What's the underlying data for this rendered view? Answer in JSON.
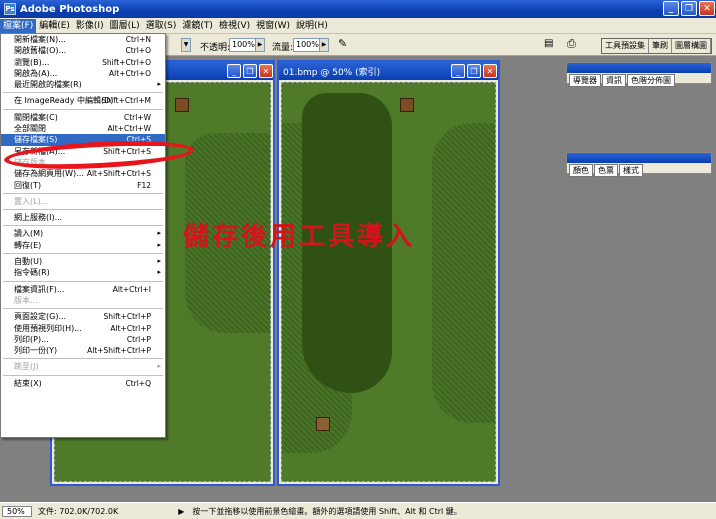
{
  "app": {
    "title": "Adobe Photoshop"
  },
  "menubar": {
    "items": [
      "檔案(F)",
      "編輯(E)",
      "影像(I)",
      "圖層(L)",
      "選取(S)",
      "濾鏡(T)",
      "檢視(V)",
      "視窗(W)",
      "說明(H)"
    ]
  },
  "options": {
    "opacity_label": "不透明:",
    "opacity_value": "100%",
    "flow_label": "流量:",
    "flow_value": "100%"
  },
  "palette_tabs": [
    "工具預設集",
    "筆刷",
    "圖層構圖"
  ],
  "palettes": [
    {
      "tabs": [
        "導覽器",
        "資訊",
        "色階分佈圖"
      ]
    },
    {
      "tabs": [
        "顏色",
        "色票",
        "樣式"
      ]
    }
  ],
  "documents": [
    {
      "title": ""
    },
    {
      "title": "01.bmp @ 50% (索引)"
    }
  ],
  "file_menu": {
    "items": [
      {
        "label": "開新檔案(N)...",
        "shortcut": "Ctrl+N"
      },
      {
        "label": "開啟舊檔(O)...",
        "shortcut": "Ctrl+O"
      },
      {
        "label": "瀏覽(B)...",
        "shortcut": "Shift+Ctrl+O"
      },
      {
        "label": "開啟為(A)...",
        "shortcut": "Alt+Ctrl+O"
      },
      {
        "label": "最近開啟的檔案(R)",
        "submenu": true
      },
      {
        "sep": true
      },
      {
        "label": "在 ImageReady 中編輯(D)",
        "shortcut": "Shift+Ctrl+M"
      },
      {
        "sep": true
      },
      {
        "label": "關閉檔案(C)",
        "shortcut": "Ctrl+W"
      },
      {
        "label": "全部關閉",
        "shortcut": "Alt+Ctrl+W"
      },
      {
        "label": "儲存檔案(S)",
        "shortcut": "Ctrl+S",
        "highlight": true
      },
      {
        "label": "另存新檔(A)...",
        "shortcut": "Shift+Ctrl+S"
      },
      {
        "label": "儲存版本...",
        "disabled": true
      },
      {
        "label": "儲存為網頁用(W)...",
        "shortcut": "Alt+Shift+Ctrl+S"
      },
      {
        "label": "回復(T)",
        "shortcut": "F12"
      },
      {
        "sep": true
      },
      {
        "label": "置入(L)...",
        "disabled": true
      },
      {
        "sep": true
      },
      {
        "label": "網上服務(I)..."
      },
      {
        "sep": true
      },
      {
        "label": "讀入(M)",
        "submenu": true
      },
      {
        "label": "轉存(E)",
        "submenu": true
      },
      {
        "sep": true
      },
      {
        "label": "自動(U)",
        "submenu": true
      },
      {
        "label": "指令碼(R)",
        "submenu": true
      },
      {
        "sep": true
      },
      {
        "label": "檔案資訊(F)...",
        "shortcut": "Alt+Ctrl+I"
      },
      {
        "label": "版本...",
        "disabled": true
      },
      {
        "sep": true
      },
      {
        "label": "頁面設定(G)...",
        "shortcut": "Shift+Ctrl+P"
      },
      {
        "label": "使用預視列印(H)...",
        "shortcut": "Alt+Ctrl+P"
      },
      {
        "label": "列印(P)...",
        "shortcut": "Ctrl+P"
      },
      {
        "label": "列印一份(Y)",
        "shortcut": "Alt+Shift+Ctrl+P"
      },
      {
        "sep": true
      },
      {
        "label": "跳至(J)",
        "disabled": true,
        "submenu": true
      },
      {
        "sep": true
      },
      {
        "label": "結束(X)",
        "shortcut": "Ctrl+Q"
      }
    ]
  },
  "annotation": {
    "text": "儲存後用工具導入",
    "color": "#d6131a"
  },
  "status": {
    "zoom": "50%",
    "doc_info": "文件: 702.0K/702.0K",
    "hint": "按一下並拖移以使用前景色繪畫。額外的選項請使用 Shift、Alt 和 Ctrl 鍵。"
  }
}
